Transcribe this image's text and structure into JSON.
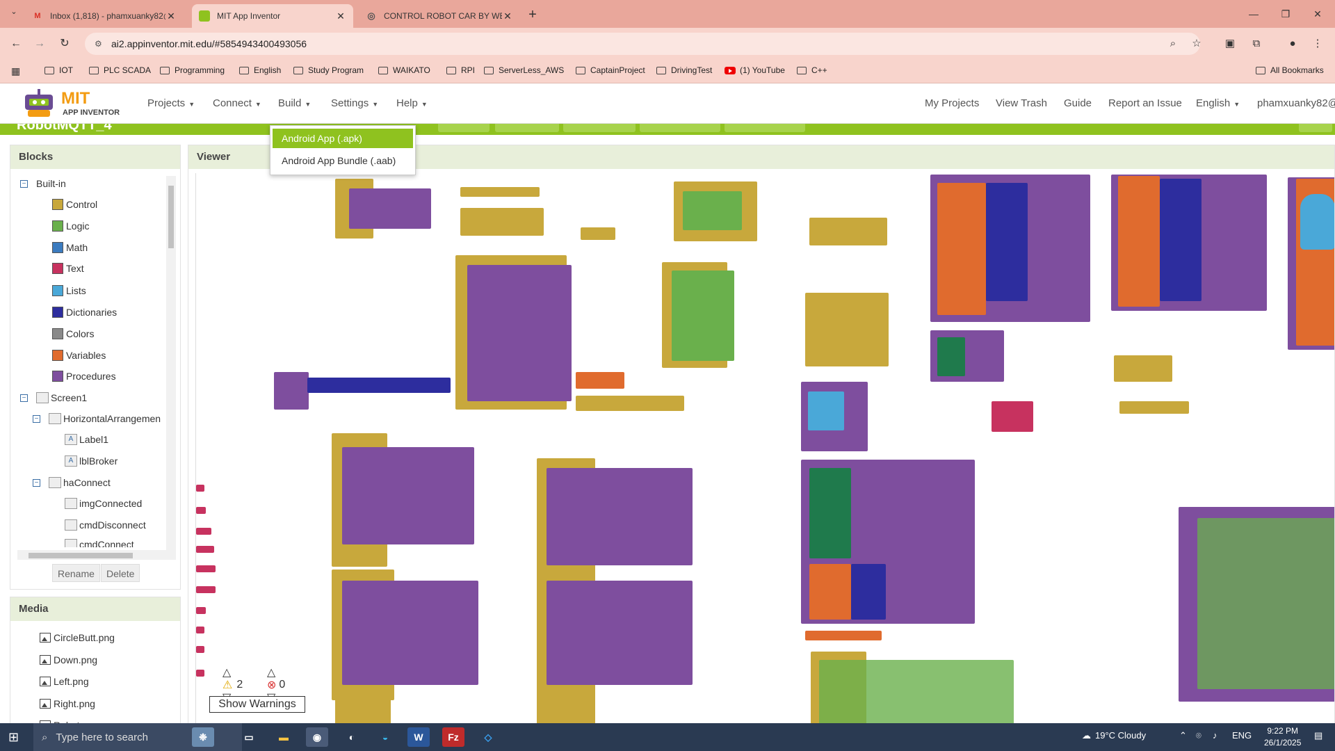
{
  "browser": {
    "tabs": [
      {
        "title": "Inbox (1,818) - phamxuanky82@",
        "icon": "gmail-icon"
      },
      {
        "title": "MIT App Inventor",
        "icon": "app-inventor-icon"
      },
      {
        "title": "CONTROL ROBOT CAR BY WEB",
        "icon": "globe-icon"
      }
    ],
    "url": "ai2.appinventor.mit.edu/#5854943400493056",
    "bookmarks": [
      "IOT",
      "PLC SCADA",
      "Programming",
      "English",
      "Study Program",
      "WAIKATO",
      "RPI",
      "ServerLess_AWS",
      "CaptainProject",
      "DrivingTest",
      "(1) YouTube",
      "C++"
    ],
    "all_bookmarks": "All Bookmarks"
  },
  "app": {
    "logo_line1": "MIT",
    "logo_line2": "APP INVENTOR",
    "menus": [
      "Projects",
      "Connect",
      "Build",
      "Settings",
      "Help"
    ],
    "right_links": [
      "My Projects",
      "View Trash",
      "Guide",
      "Report an Issue",
      "English",
      "phamxuanky82@g"
    ],
    "project_name": "RobotMQTT_4",
    "build_menu": [
      "Android App (.apk)",
      "Android App Bundle (.aab)"
    ]
  },
  "blocks": {
    "title": "Blocks",
    "builtin_label": "Built-in",
    "builtin": [
      {
        "label": "Control",
        "color": "#c8a83c"
      },
      {
        "label": "Logic",
        "color": "#6ab04c"
      },
      {
        "label": "Math",
        "color": "#3b7bbf"
      },
      {
        "label": "Text",
        "color": "#c7325f"
      },
      {
        "label": "Lists",
        "color": "#4aa8d8"
      },
      {
        "label": "Dictionaries",
        "color": "#2d2d9e"
      },
      {
        "label": "Colors",
        "color": "#8a8a8a"
      },
      {
        "label": "Variables",
        "color": "#e06b2e"
      },
      {
        "label": "Procedures",
        "color": "#7e4e9e"
      }
    ],
    "screen": "Screen1",
    "components": [
      {
        "label": "HorizontalArrangemen",
        "level": 1
      },
      {
        "label": "Label1",
        "level": 2
      },
      {
        "label": "lblBroker",
        "level": 2
      },
      {
        "label": "haConnect",
        "level": 1
      },
      {
        "label": "imgConnected",
        "level": 2
      },
      {
        "label": "cmdDisconnect",
        "level": 2
      },
      {
        "label": "cmdConnect",
        "level": 2
      }
    ],
    "rename": "Rename",
    "delete": "Delete"
  },
  "media": {
    "title": "Media",
    "files": [
      "CircleButt.png",
      "Down.png",
      "Left.png",
      "Right.png",
      "Robot.png"
    ]
  },
  "viewer": {
    "title": "Viewer",
    "warnings": "2",
    "errors": "0",
    "show_warnings": "Show Warnings"
  },
  "taskbar": {
    "search_placeholder": "Type here to search",
    "weather": "19°C  Cloudy",
    "lang": "ENG",
    "time": "9:22 PM",
    "date": "26/1/2025"
  }
}
